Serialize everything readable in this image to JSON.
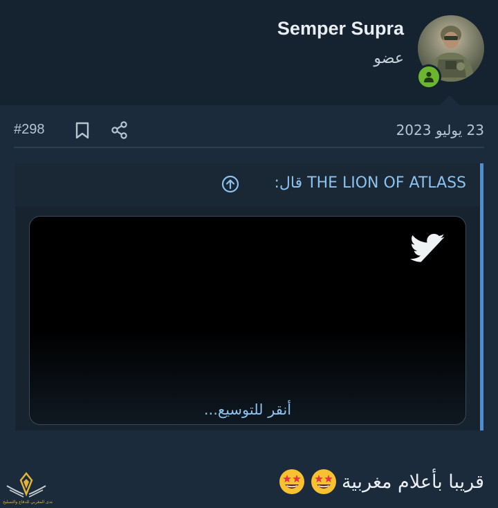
{
  "user": {
    "name": "Semper Supra",
    "title": "عضو"
  },
  "post": {
    "date": "23 يوليو 2023",
    "number": "#298",
    "body_text": "قريبا بأعلام مغربية"
  },
  "quote": {
    "author_line": "THE LION OF ATLASS قال:",
    "expand_label": "أنقر للتوسيع..."
  },
  "icons": {
    "avatar": "avatar-image",
    "online": "user-online-icon",
    "bookmark": "bookmark-icon",
    "share": "share-icon",
    "quote_jump": "arrow-up-circle-icon",
    "embed": "twitter-bird-icon",
    "emoji": "star-struck-emoji"
  },
  "watermark": {
    "text": "المنتدى المغربي للدفاع والتسليح"
  },
  "colors": {
    "background": "#1c2b3b",
    "header": "#152230",
    "accent_link": "#8cc2ef",
    "quote_border": "#4e8fcf",
    "online_green": "#6bb531"
  }
}
